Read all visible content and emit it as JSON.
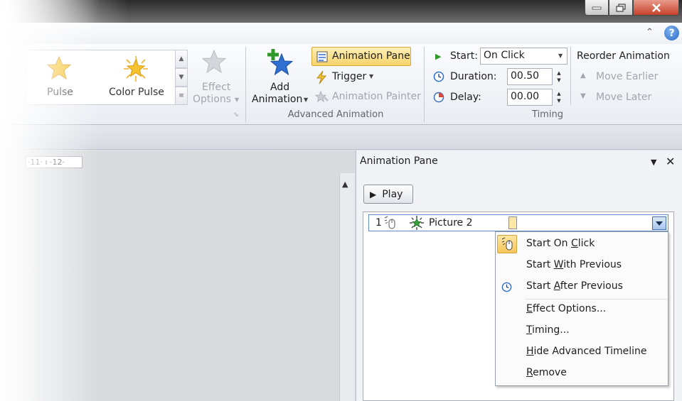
{
  "window": {
    "help_glyph": "?",
    "ribbon_collapse_glyph": "⌃"
  },
  "ribbon": {
    "effects": [
      {
        "label": "Pulse",
        "icon": "star-icon"
      },
      {
        "label": "Color Pulse",
        "icon": "color-pulse-star-icon"
      }
    ],
    "effect_options": {
      "line1": "Effect",
      "line2": "Options"
    },
    "advanced_animation": {
      "add_animation_line1": "Add",
      "add_animation_line2": "Animation",
      "animation_pane": "Animation Pane",
      "trigger": "Trigger",
      "animation_painter": "Animation Painter",
      "group_label": "Advanced Animation"
    },
    "timing": {
      "start_label": "Start:",
      "start_value": "On Click",
      "duration_label": "Duration:",
      "duration_value": "00.50",
      "delay_label": "Delay:",
      "delay_value": "00.00",
      "group_label": "Timing"
    },
    "reorder": {
      "title": "Reorder Animation",
      "move_earlier": "Move Earlier",
      "move_later": "Move Later"
    }
  },
  "ruler": {
    "text": "·11· ı ·12·"
  },
  "animation_pane": {
    "title": "Animation Pane",
    "play_label": "Play",
    "item": {
      "number": "1",
      "name": "Picture 2"
    },
    "menu": [
      {
        "pre": "Start On ",
        "key": "C",
        "post": "lick"
      },
      {
        "pre": "Start ",
        "key": "W",
        "post": "ith Previous"
      },
      {
        "pre": "Start ",
        "key": "A",
        "post": "fter Previous"
      },
      {
        "pre": "",
        "key": "E",
        "post": "ffect Options..."
      },
      {
        "pre": "",
        "key": "T",
        "post": "iming..."
      },
      {
        "pre": "",
        "key": "H",
        "post": "ide Advanced Timeline"
      },
      {
        "pre": "",
        "key": "R",
        "post": "emove"
      }
    ]
  },
  "colors": {
    "accent_highlight": "#fbe293",
    "selection_border": "#5f8fd1",
    "close_red": "#c8422b"
  }
}
